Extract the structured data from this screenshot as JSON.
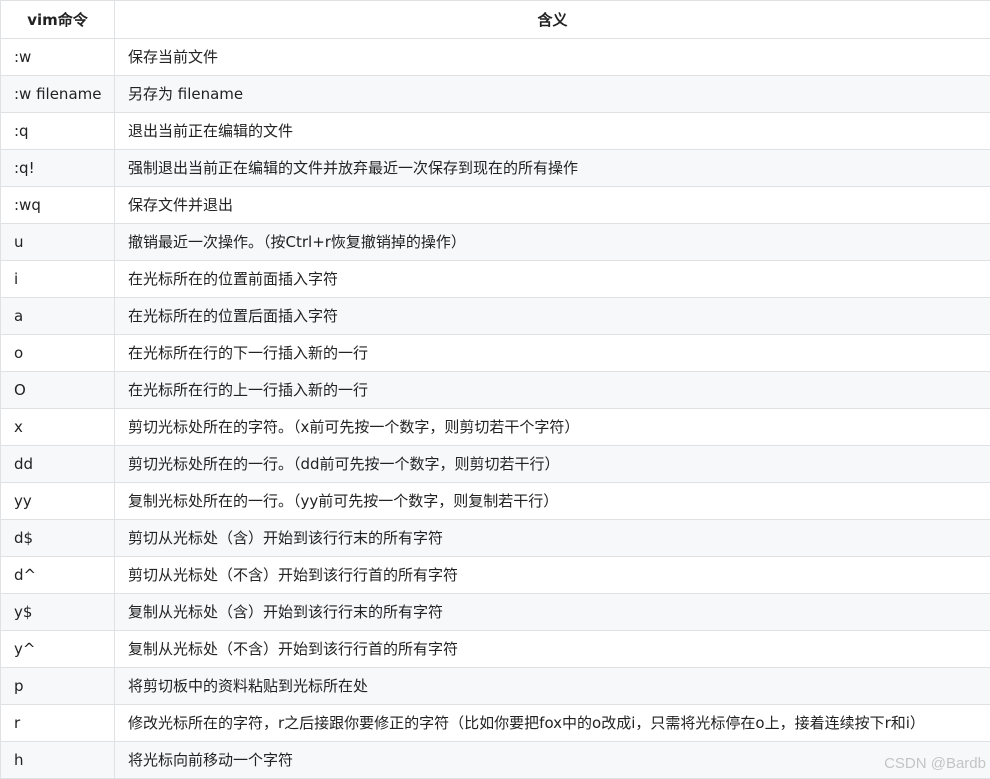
{
  "table": {
    "headers": [
      "vim命令",
      "含义"
    ],
    "rows": [
      [
        ":w",
        "保存当前文件"
      ],
      [
        ":w filename",
        "另存为 filename"
      ],
      [
        ":q",
        "退出当前正在编辑的文件"
      ],
      [
        ":q!",
        "强制退出当前正在编辑的文件并放弃最近一次保存到现在的所有操作"
      ],
      [
        ":wq",
        "保存文件并退出"
      ],
      [
        "u",
        "撤销最近一次操作。（按Ctrl+r恢复撤销掉的操作）"
      ],
      [
        "i",
        "在光标所在的位置前面插入字符"
      ],
      [
        "a",
        "在光标所在的位置后面插入字符"
      ],
      [
        "o",
        "在光标所在行的下一行插入新的一行"
      ],
      [
        "O",
        "在光标所在行的上一行插入新的一行"
      ],
      [
        "x",
        "剪切光标处所在的字符。（x前可先按一个数字，则剪切若干个字符）"
      ],
      [
        "dd",
        "剪切光标处所在的一行。（dd前可先按一个数字，则剪切若干行）"
      ],
      [
        "yy",
        "复制光标处所在的一行。（yy前可先按一个数字，则复制若干行）"
      ],
      [
        "d$",
        "剪切从光标处（含）开始到该行行末的所有字符"
      ],
      [
        "d^",
        "剪切从光标处（不含）开始到该行行首的所有字符"
      ],
      [
        "y$",
        "复制从光标处（含）开始到该行行末的所有字符"
      ],
      [
        "y^",
        "复制从光标处（不含）开始到该行行首的所有字符"
      ],
      [
        "p",
        "将剪切板中的资料粘贴到光标所在处"
      ],
      [
        "r",
        "修改光标所在的字符，r之后接跟你要修正的字符（比如你要把fox中的o改成i，只需将光标停在o上，接着连续按下r和i）"
      ],
      [
        "h",
        "将光标向前移动一个字符"
      ]
    ]
  },
  "watermark": "CSDN @Bardb"
}
